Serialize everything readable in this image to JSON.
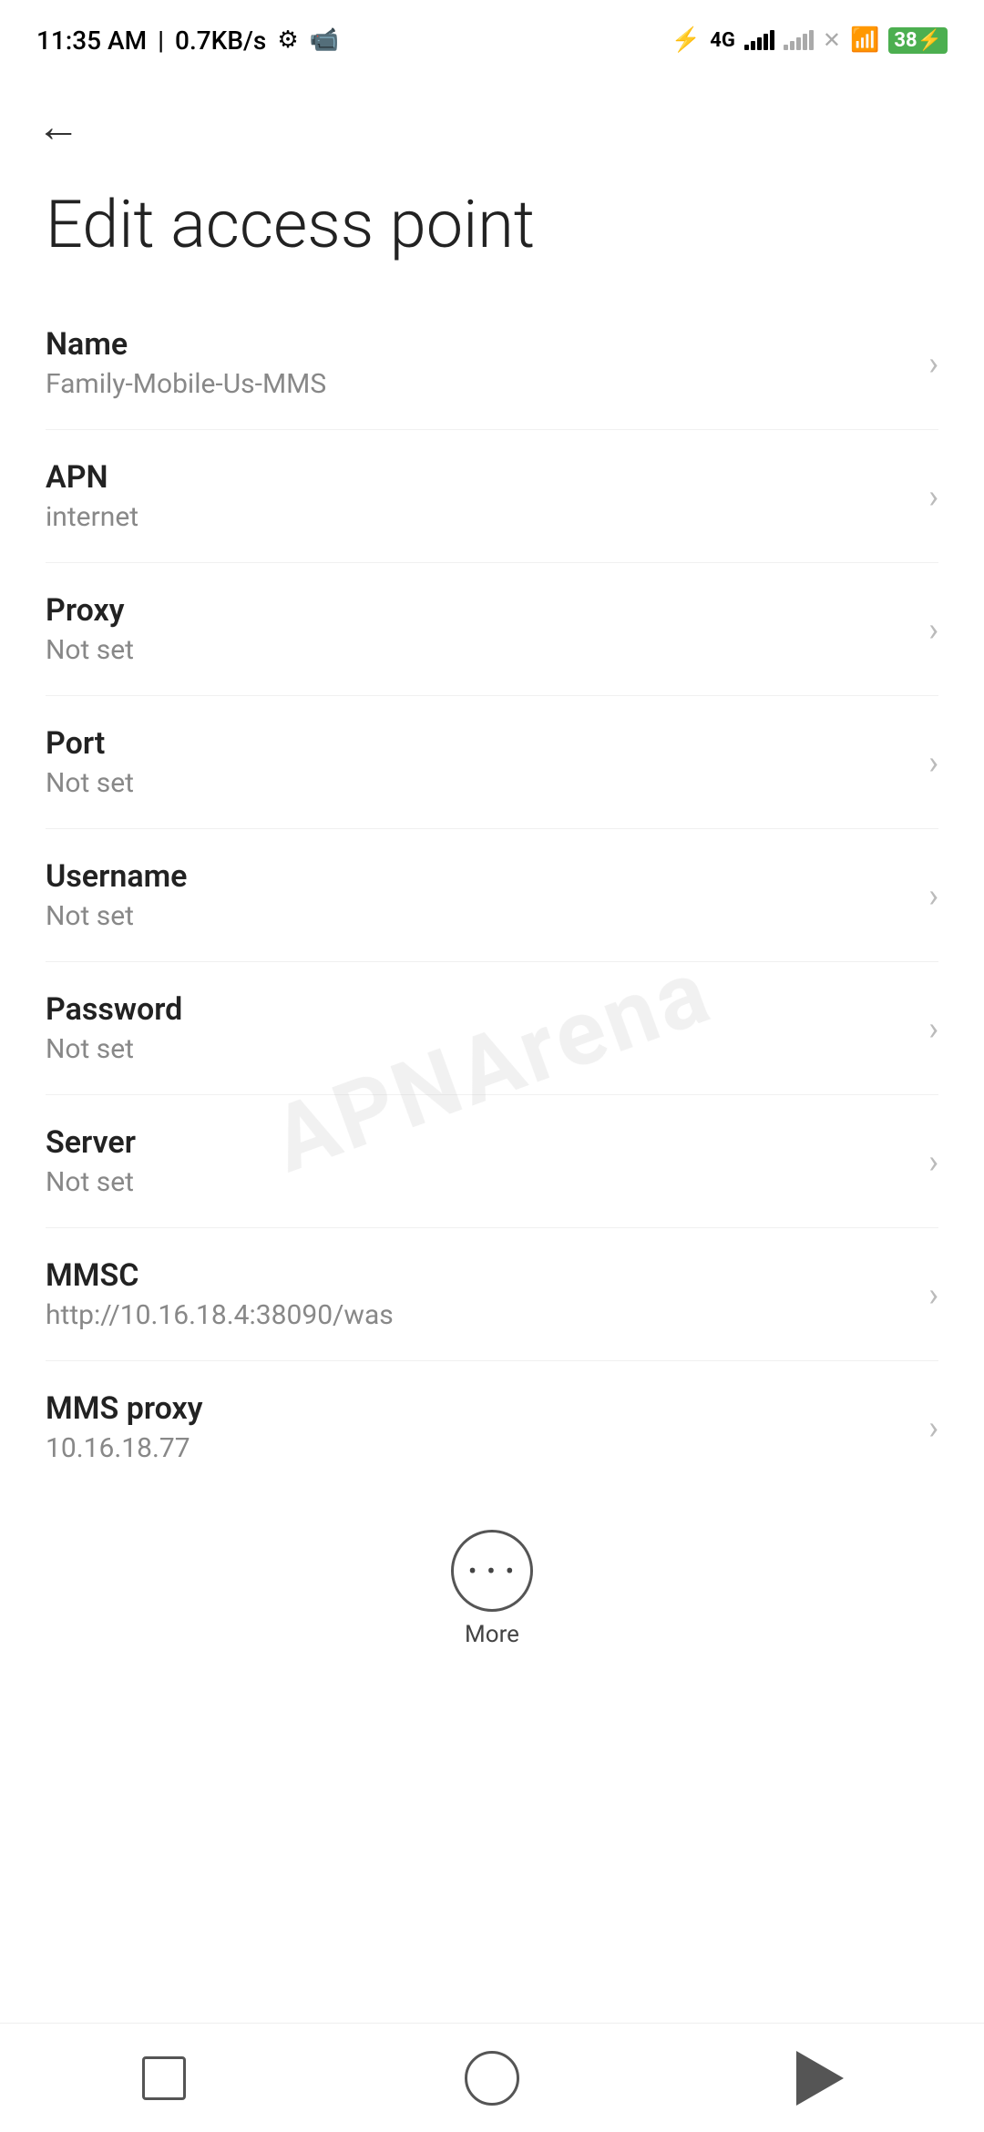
{
  "statusBar": {
    "time": "11:35 AM",
    "speed": "0.7KB/s",
    "battery": "38",
    "batterySymbol": "⚡"
  },
  "header": {
    "backLabel": "←",
    "title": "Edit access point"
  },
  "settings": {
    "items": [
      {
        "label": "Name",
        "value": "Family-Mobile-Us-MMS"
      },
      {
        "label": "APN",
        "value": "internet"
      },
      {
        "label": "Proxy",
        "value": "Not set"
      },
      {
        "label": "Port",
        "value": "Not set"
      },
      {
        "label": "Username",
        "value": "Not set"
      },
      {
        "label": "Password",
        "value": "Not set"
      },
      {
        "label": "Server",
        "value": "Not set"
      },
      {
        "label": "MMSC",
        "value": "http://10.16.18.4:38090/was"
      },
      {
        "label": "MMS proxy",
        "value": "10.16.18.77"
      }
    ]
  },
  "more": {
    "label": "More",
    "dotsSymbol": "···"
  },
  "watermark": "APNArena",
  "navbar": {
    "square": "▢",
    "circle": "○",
    "triangle": "◁"
  }
}
